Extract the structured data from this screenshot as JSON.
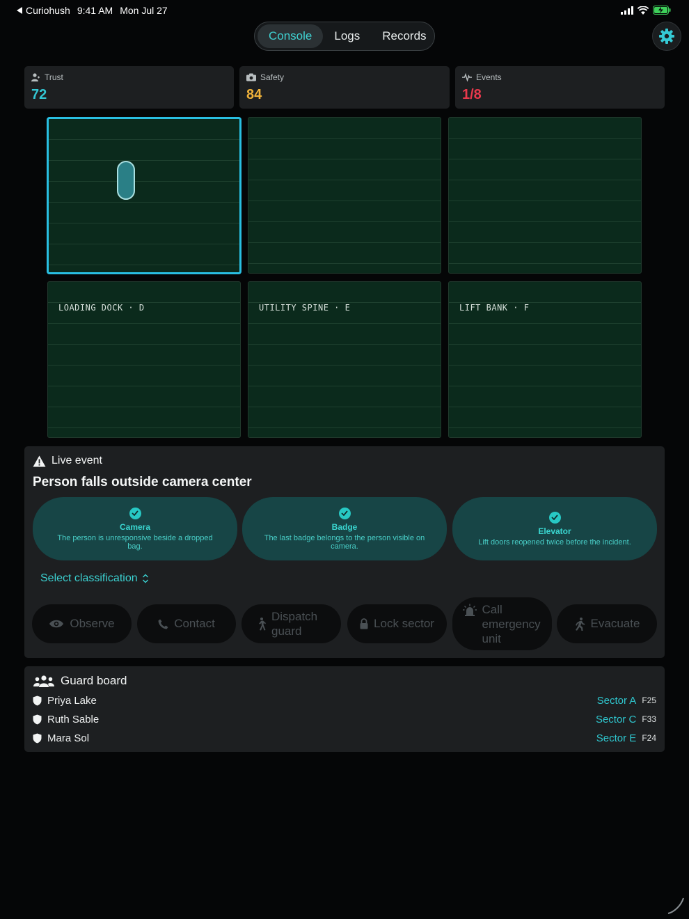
{
  "status_bar": {
    "app": "Curiohush",
    "time": "9:41 AM",
    "date": "Mon Jul 27"
  },
  "nav": {
    "tabs": [
      {
        "label": "Console",
        "active": true
      },
      {
        "label": "Logs",
        "active": false
      },
      {
        "label": "Records",
        "active": false
      }
    ]
  },
  "metrics": [
    {
      "label": "Trust",
      "value": "72",
      "color": "#33c6d3",
      "icon": "person-icon"
    },
    {
      "label": "Safety",
      "value": "84",
      "color": "#f0b23a",
      "icon": "camera-icon"
    },
    {
      "label": "Events",
      "value": "1/8",
      "color": "#e8394c",
      "icon": "pulse-icon"
    }
  ],
  "grid": {
    "tiles": [
      {
        "label": "",
        "selected": true,
        "has_person": true
      },
      {
        "label": "",
        "selected": false
      },
      {
        "label": "",
        "selected": false
      },
      {
        "label": "LOADING DOCK · D",
        "selected": false
      },
      {
        "label": "UTILITY SPINE · E",
        "selected": false
      },
      {
        "label": "LIFT BANK · F",
        "selected": false
      }
    ]
  },
  "live_event": {
    "heading": "Live event",
    "title": "Person falls outside camera center",
    "evidence": [
      {
        "name": "Camera",
        "desc": "The person is unresponsive beside a dropped bag."
      },
      {
        "name": "Badge",
        "desc": "The last badge belongs to the person visible on camera."
      },
      {
        "name": "Elevator",
        "desc": "Lift doors reopened twice before the incident."
      }
    ],
    "classify_label": "Select classification",
    "actions": [
      {
        "label": "Observe",
        "icon": "eye-icon"
      },
      {
        "label": "Contact",
        "icon": "phone-icon"
      },
      {
        "label": "Dispatch guard",
        "icon": "walk-icon"
      },
      {
        "label": "Lock sector",
        "icon": "lock-icon"
      },
      {
        "label": "Call emergency unit",
        "icon": "siren-icon"
      },
      {
        "label": "Evacuate",
        "icon": "run-icon"
      }
    ]
  },
  "guard_board": {
    "heading": "Guard board",
    "guards": [
      {
        "name": "Priya Lake",
        "sector": "Sector A",
        "floor": "F25"
      },
      {
        "name": "Ruth Sable",
        "sector": "Sector C",
        "floor": "F33"
      },
      {
        "name": "Mara Sol",
        "sector": "Sector E",
        "floor": "F24"
      }
    ]
  }
}
